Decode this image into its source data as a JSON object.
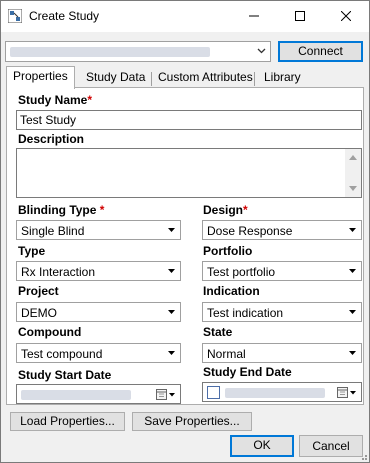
{
  "window": {
    "title": "Create Study"
  },
  "connection": {
    "server_value": "",
    "connect_label": "Connect"
  },
  "tabs": [
    {
      "label": "Properties"
    },
    {
      "label": "Study Data"
    },
    {
      "label": "Custom Attributes"
    },
    {
      "label": "Library"
    }
  ],
  "form": {
    "study_name": {
      "label": "Study Name",
      "required_mark": "*",
      "value": "Test Study"
    },
    "description": {
      "label": "Description",
      "value": ""
    },
    "blinding_type": {
      "label": "Blinding Type",
      "required_mark": "*",
      "value": "Single Blind"
    },
    "design": {
      "label": "Design",
      "required_mark": "*",
      "value": "Dose Response"
    },
    "type": {
      "label": "Type",
      "value": "Rx Interaction"
    },
    "portfolio": {
      "label": "Portfolio",
      "value": "Test portfolio"
    },
    "project": {
      "label": "Project",
      "value": "DEMO"
    },
    "indication": {
      "label": "Indication",
      "value": "Test indication"
    },
    "compound": {
      "label": "Compound",
      "value": "Test compound"
    },
    "state": {
      "label": "State",
      "value": "Normal"
    },
    "study_start_date": {
      "label": "Study Start Date",
      "value": ""
    },
    "study_end_date": {
      "label": "Study End Date",
      "value": ""
    }
  },
  "buttons": {
    "load_properties": "Load Properties...",
    "save_properties": "Save Properties...",
    "ok": "OK",
    "cancel": "Cancel"
  },
  "colors": {
    "required": "#d00000",
    "accent": "#0078d7"
  }
}
